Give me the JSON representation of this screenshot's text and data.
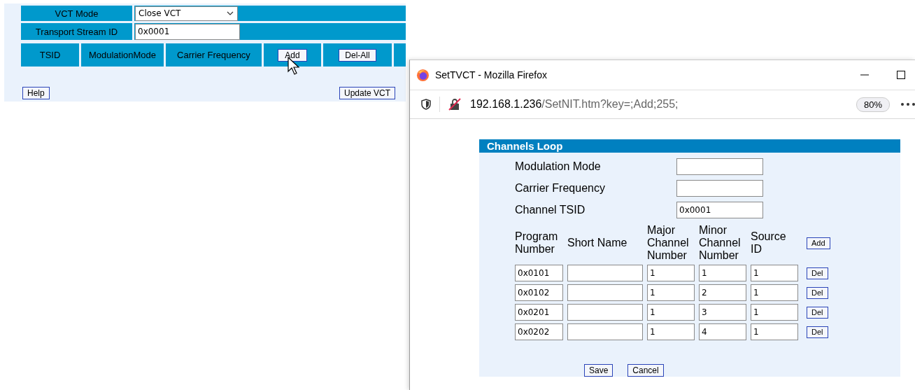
{
  "main": {
    "vct_mode": {
      "label": "VCT Mode",
      "value": "Close VCT"
    },
    "transport_stream_id": {
      "label": "Transport Stream ID",
      "value": "0x0001"
    },
    "columns": [
      "TSID",
      "ModulationMode",
      "Carrier Frequency"
    ],
    "header_buttons": [
      "Add",
      "Del-All"
    ],
    "buttons": [
      "Help",
      "Update VCT"
    ]
  },
  "popup": {
    "title": "SetTVCT - Mozilla Firefox",
    "url_host": "192.168.1.236",
    "url_path": "/SetNIT.htm?key=;Add;255;",
    "zoom": "80%",
    "section_title": "Channels Loop",
    "fields": [
      {
        "label": "Modulation Mode"
      },
      {
        "label": "Carrier Frequency"
      },
      {
        "label": "Channel TSID",
        "value": "0x0001"
      }
    ],
    "columns": [
      "Program Number",
      "Short Name",
      "Major Channel Number",
      "Minor Channel Number",
      "Source ID"
    ],
    "add_button": "Add",
    "rows": [
      {
        "program_number": "0x0101",
        "major": "1",
        "minor": "1",
        "source_id": "1",
        "button": "Del"
      },
      {
        "program_number": "0x0102",
        "major": "1",
        "minor": "2",
        "source_id": "1",
        "button": "Del"
      },
      {
        "program_number": "0x0201",
        "major": "1",
        "minor": "3",
        "source_id": "1",
        "button": "Del"
      },
      {
        "program_number": "0x0202",
        "major": "1",
        "minor": "4",
        "source_id": "1",
        "button": "Del"
      }
    ],
    "buttons": [
      "Save",
      "Cancel"
    ]
  }
}
